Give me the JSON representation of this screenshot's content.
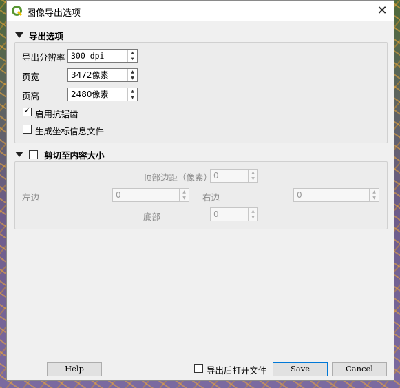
{
  "window": {
    "title": "图像导出选项"
  },
  "export_options": {
    "header": "导出选项",
    "resolution": {
      "label": "导出分辨率",
      "value": "300 dpi"
    },
    "page_width": {
      "label": "页宽",
      "value": "3472像素"
    },
    "page_height": {
      "label": "页高",
      "value": "2480像素"
    },
    "antialiasing": {
      "label": "启用抗锯齿",
      "checked": true
    },
    "world_file": {
      "label": "生成坐标信息文件",
      "checked": false
    }
  },
  "crop": {
    "header": "剪切至内容大小",
    "enabled": false,
    "top": {
      "label": "顶部边距（像素）",
      "value": "0"
    },
    "left": {
      "label": "左边",
      "value": "0"
    },
    "right": {
      "label": "右边",
      "value": "0"
    },
    "bottom": {
      "label": "底部",
      "value": "0"
    }
  },
  "footer": {
    "help_label": "Help",
    "open_after_label": "导出后打开文件",
    "open_after_checked": false,
    "save_label": "Save",
    "cancel_label": "Cancel"
  },
  "colors": {
    "accent": "#0078d7",
    "qgis_green": "#589632"
  }
}
